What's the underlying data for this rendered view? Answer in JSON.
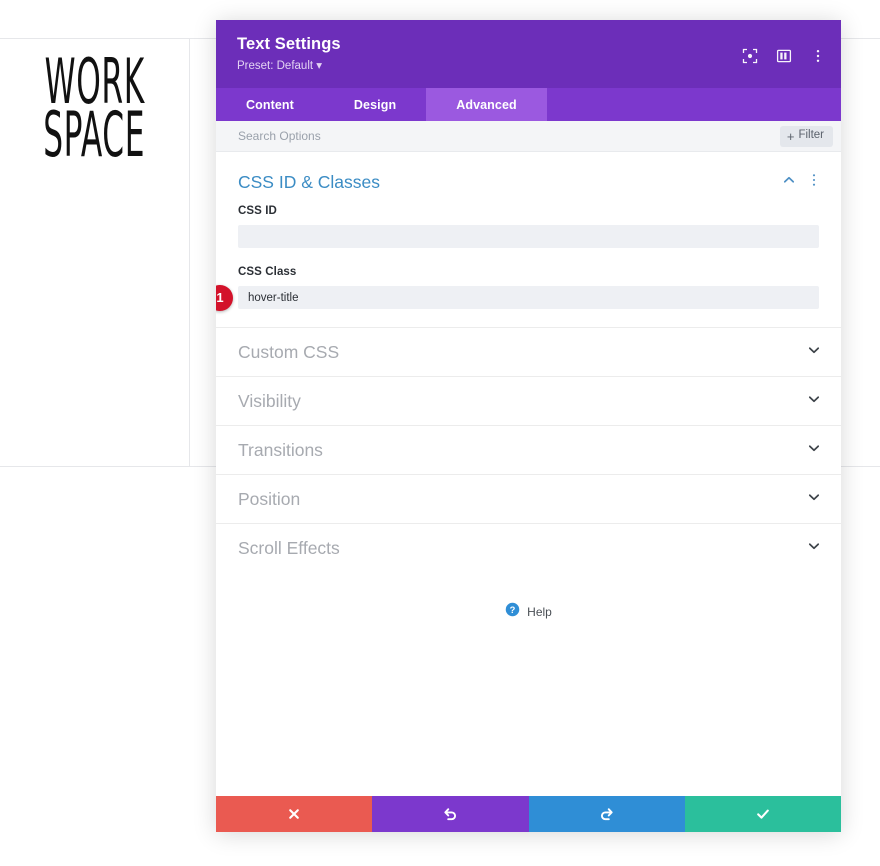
{
  "background": {
    "logo_line1": "WORK",
    "logo_line2": "SPACE"
  },
  "panel": {
    "title": "Text Settings",
    "preset": "Preset: Default ▾",
    "header_icons": [
      {
        "name": "fullscreen-icon"
      },
      {
        "name": "layout-panel-icon"
      },
      {
        "name": "kebab-menu-icon"
      }
    ],
    "tabs": [
      {
        "label": "Content",
        "active": false
      },
      {
        "label": "Design",
        "active": false
      },
      {
        "label": "Advanced",
        "active": true
      }
    ],
    "search": {
      "placeholder": "Search Options",
      "value": "",
      "filter_label": "Filter",
      "filter_plus": "+"
    },
    "open_section": {
      "title": "CSS ID & Classes",
      "fields": [
        {
          "label": "CSS ID",
          "value": "",
          "badge": null
        },
        {
          "label": "CSS Class",
          "value": "hover-title",
          "badge": "1"
        }
      ]
    },
    "collapsed_sections": [
      {
        "label": "Custom CSS"
      },
      {
        "label": "Visibility"
      },
      {
        "label": "Transitions"
      },
      {
        "label": "Position"
      },
      {
        "label": "Scroll Effects"
      }
    ],
    "help": {
      "label": "Help"
    },
    "footer_buttons": [
      {
        "name": "cancel-button",
        "icon": "close-icon"
      },
      {
        "name": "undo-button",
        "icon": "undo-icon"
      },
      {
        "name": "redo-button",
        "icon": "redo-icon"
      },
      {
        "name": "save-button",
        "icon": "check-icon"
      }
    ]
  },
  "colors": {
    "header_purple": "#6c2eb9",
    "tabs_purple": "#7c38cd",
    "active_tab_purple": "#9b59e0",
    "section_title_blue": "#3b8cc4",
    "badge_red": "#d3122a",
    "cancel_red": "#ea5a51",
    "undo_purple": "#7c38cd",
    "redo_blue": "#2f8ed6",
    "save_green": "#2bbf9c"
  }
}
